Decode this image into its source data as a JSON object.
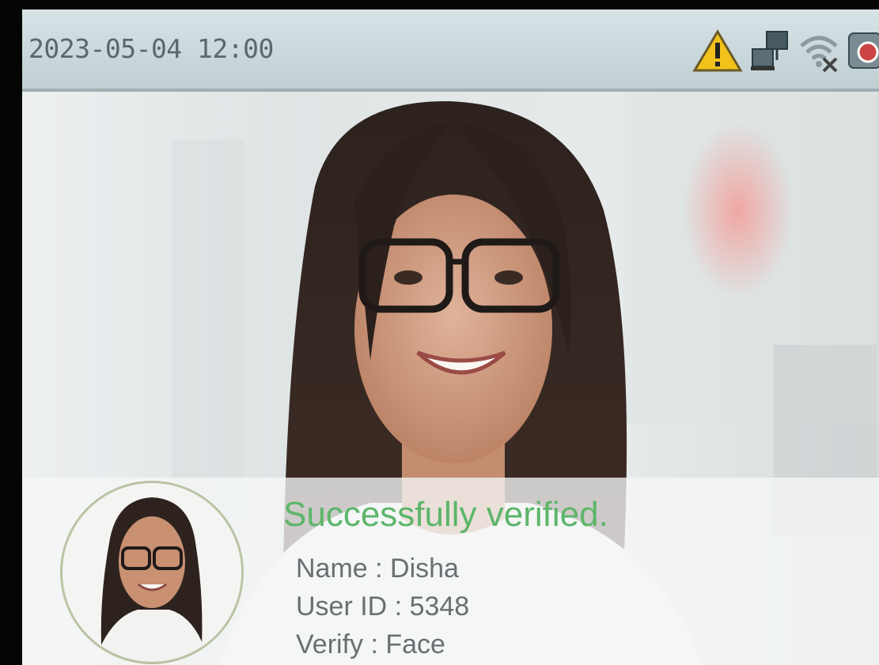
{
  "status_bar": {
    "datetime": "2023-05-04 12:00",
    "icons": [
      "warning-icon",
      "network-icon",
      "wifi-disconnected-icon",
      "cloud-server-icon"
    ]
  },
  "verification": {
    "message": "Successfully verified.",
    "name": "Name : Disha",
    "user_id": "User ID : 5348",
    "verify_method": "Verify : Face"
  },
  "colors": {
    "success": "#5db56a",
    "status_bar": "#c9d7da",
    "warning": "#f2c21a"
  }
}
